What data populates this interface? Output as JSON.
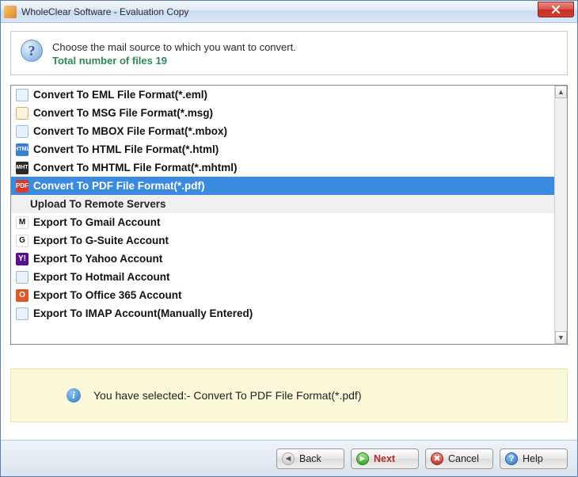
{
  "window": {
    "title": "WholeClear Software - Evaluation Copy"
  },
  "header": {
    "line1": "Choose the mail source to which you want to convert.",
    "line2": "Total number of files 19"
  },
  "list": {
    "items": [
      {
        "icon": "eml",
        "label": "Convert To EML File Format(*.eml)",
        "selected": false,
        "group": false
      },
      {
        "icon": "msg",
        "label": "Convert To MSG File Format(*.msg)",
        "selected": false,
        "group": false
      },
      {
        "icon": "mbox",
        "label": "Convert To MBOX File Format(*.mbox)",
        "selected": false,
        "group": false
      },
      {
        "icon": "html",
        "label": "Convert To HTML File Format(*.html)",
        "selected": false,
        "group": false
      },
      {
        "icon": "mhtml",
        "label": "Convert To MHTML File Format(*.mhtml)",
        "selected": false,
        "group": false
      },
      {
        "icon": "pdf",
        "label": "Convert To PDF File Format(*.pdf)",
        "selected": true,
        "group": false
      },
      {
        "icon": "",
        "label": "Upload To Remote Servers",
        "selected": false,
        "group": true
      },
      {
        "icon": "gmail",
        "label": "Export To Gmail Account",
        "selected": false,
        "group": false
      },
      {
        "icon": "gsuite",
        "label": "Export To G-Suite Account",
        "selected": false,
        "group": false
      },
      {
        "icon": "yahoo",
        "label": "Export To Yahoo Account",
        "selected": false,
        "group": false
      },
      {
        "icon": "hotmail",
        "label": "Export To Hotmail Account",
        "selected": false,
        "group": false
      },
      {
        "icon": "o365",
        "label": "Export To Office 365 Account",
        "selected": false,
        "group": false
      },
      {
        "icon": "imap",
        "label": "Export To IMAP Account(Manually Entered)",
        "selected": false,
        "group": false
      }
    ]
  },
  "status": {
    "text": "You have selected:- Convert To PDF File Format(*.pdf)"
  },
  "footer": {
    "back": "Back",
    "next": "Next",
    "cancel": "Cancel",
    "help": "Help"
  },
  "iconText": {
    "eml": "",
    "msg": "",
    "mbox": "",
    "html": "HTML",
    "mhtml": "MHT",
    "pdf": "PDF",
    "gmail": "M",
    "gsuite": "G",
    "yahoo": "Y!",
    "hotmail": "",
    "o365": "O",
    "imap": ""
  }
}
